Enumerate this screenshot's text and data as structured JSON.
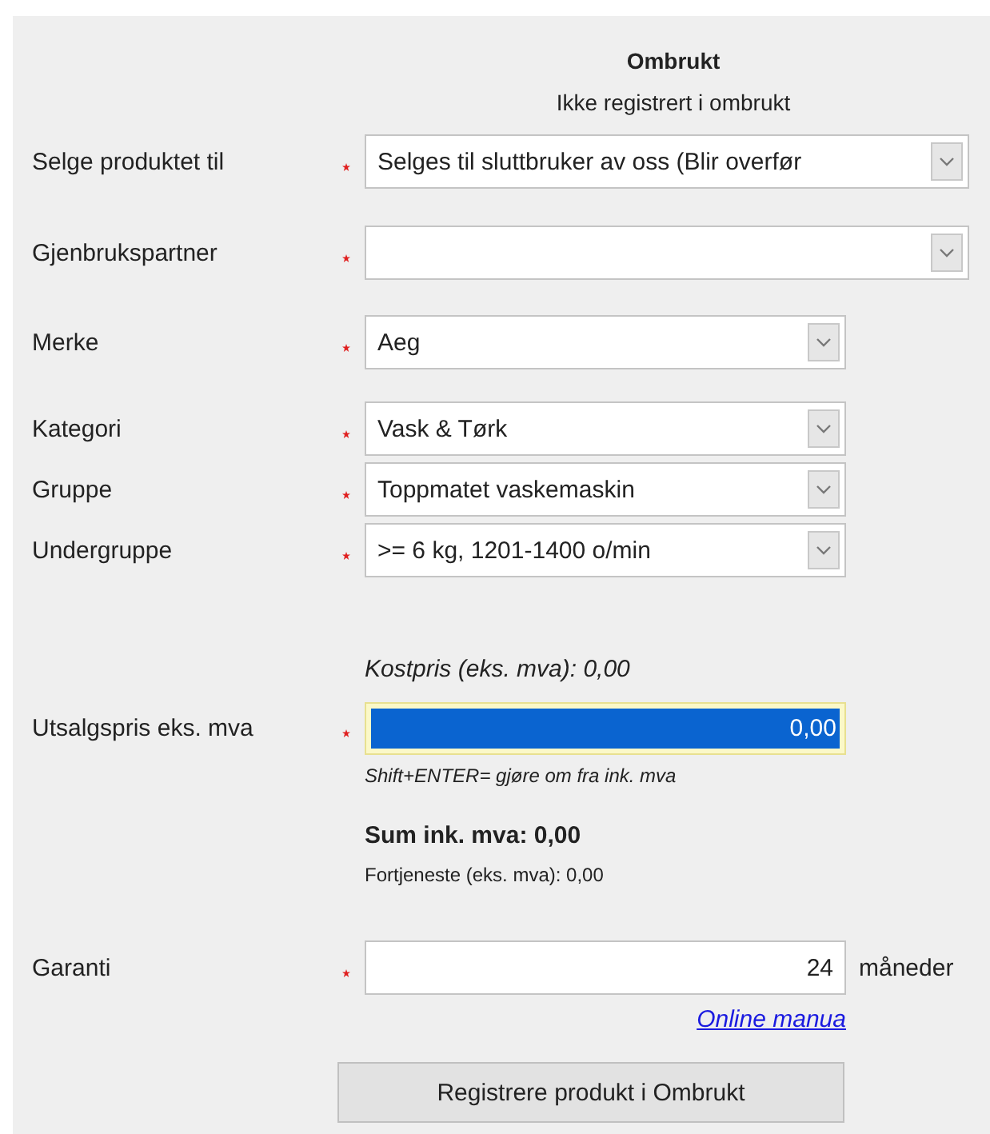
{
  "header": {
    "title": "Ombrukt",
    "subtitle": "Ikke registrert i ombrukt"
  },
  "selects": [
    {
      "label": "Selge produktet til",
      "required": true,
      "value": "Selges til sluttbruker av oss (Blir overfør"
    },
    {
      "label": "Gjenbrukspartner",
      "required": true
    },
    {
      "label": "Merke",
      "required": true,
      "value": "Aeg"
    },
    {
      "label": "Kategori",
      "required": true,
      "value": "Vask & Tørk"
    },
    {
      "label": "Gruppe",
      "required": true,
      "value": "Toppmatet vaskemaskin"
    },
    {
      "label": "Undergruppe",
      "required": true,
      "value": ">= 6 kg, 1201-1400 o/min"
    }
  ],
  "price": {
    "cost_note": "Kostpris (eks. mva): 0,00",
    "label": "Utsalgspris eks. mva",
    "required": true,
    "value": "0,00",
    "focused": true,
    "hint": "Shift+ENTER= gjøre om fra ink. mva",
    "sum": "Sum ink. mva: 0,00",
    "profit": "Fortjeneste (eks. mva): 0,00"
  },
  "warranty": {
    "label": "Garanti",
    "required": true,
    "value": "24",
    "unit": "måneder"
  },
  "link": "Online manua",
  "submit_button": "Registrere produkt i Ombrukt"
}
